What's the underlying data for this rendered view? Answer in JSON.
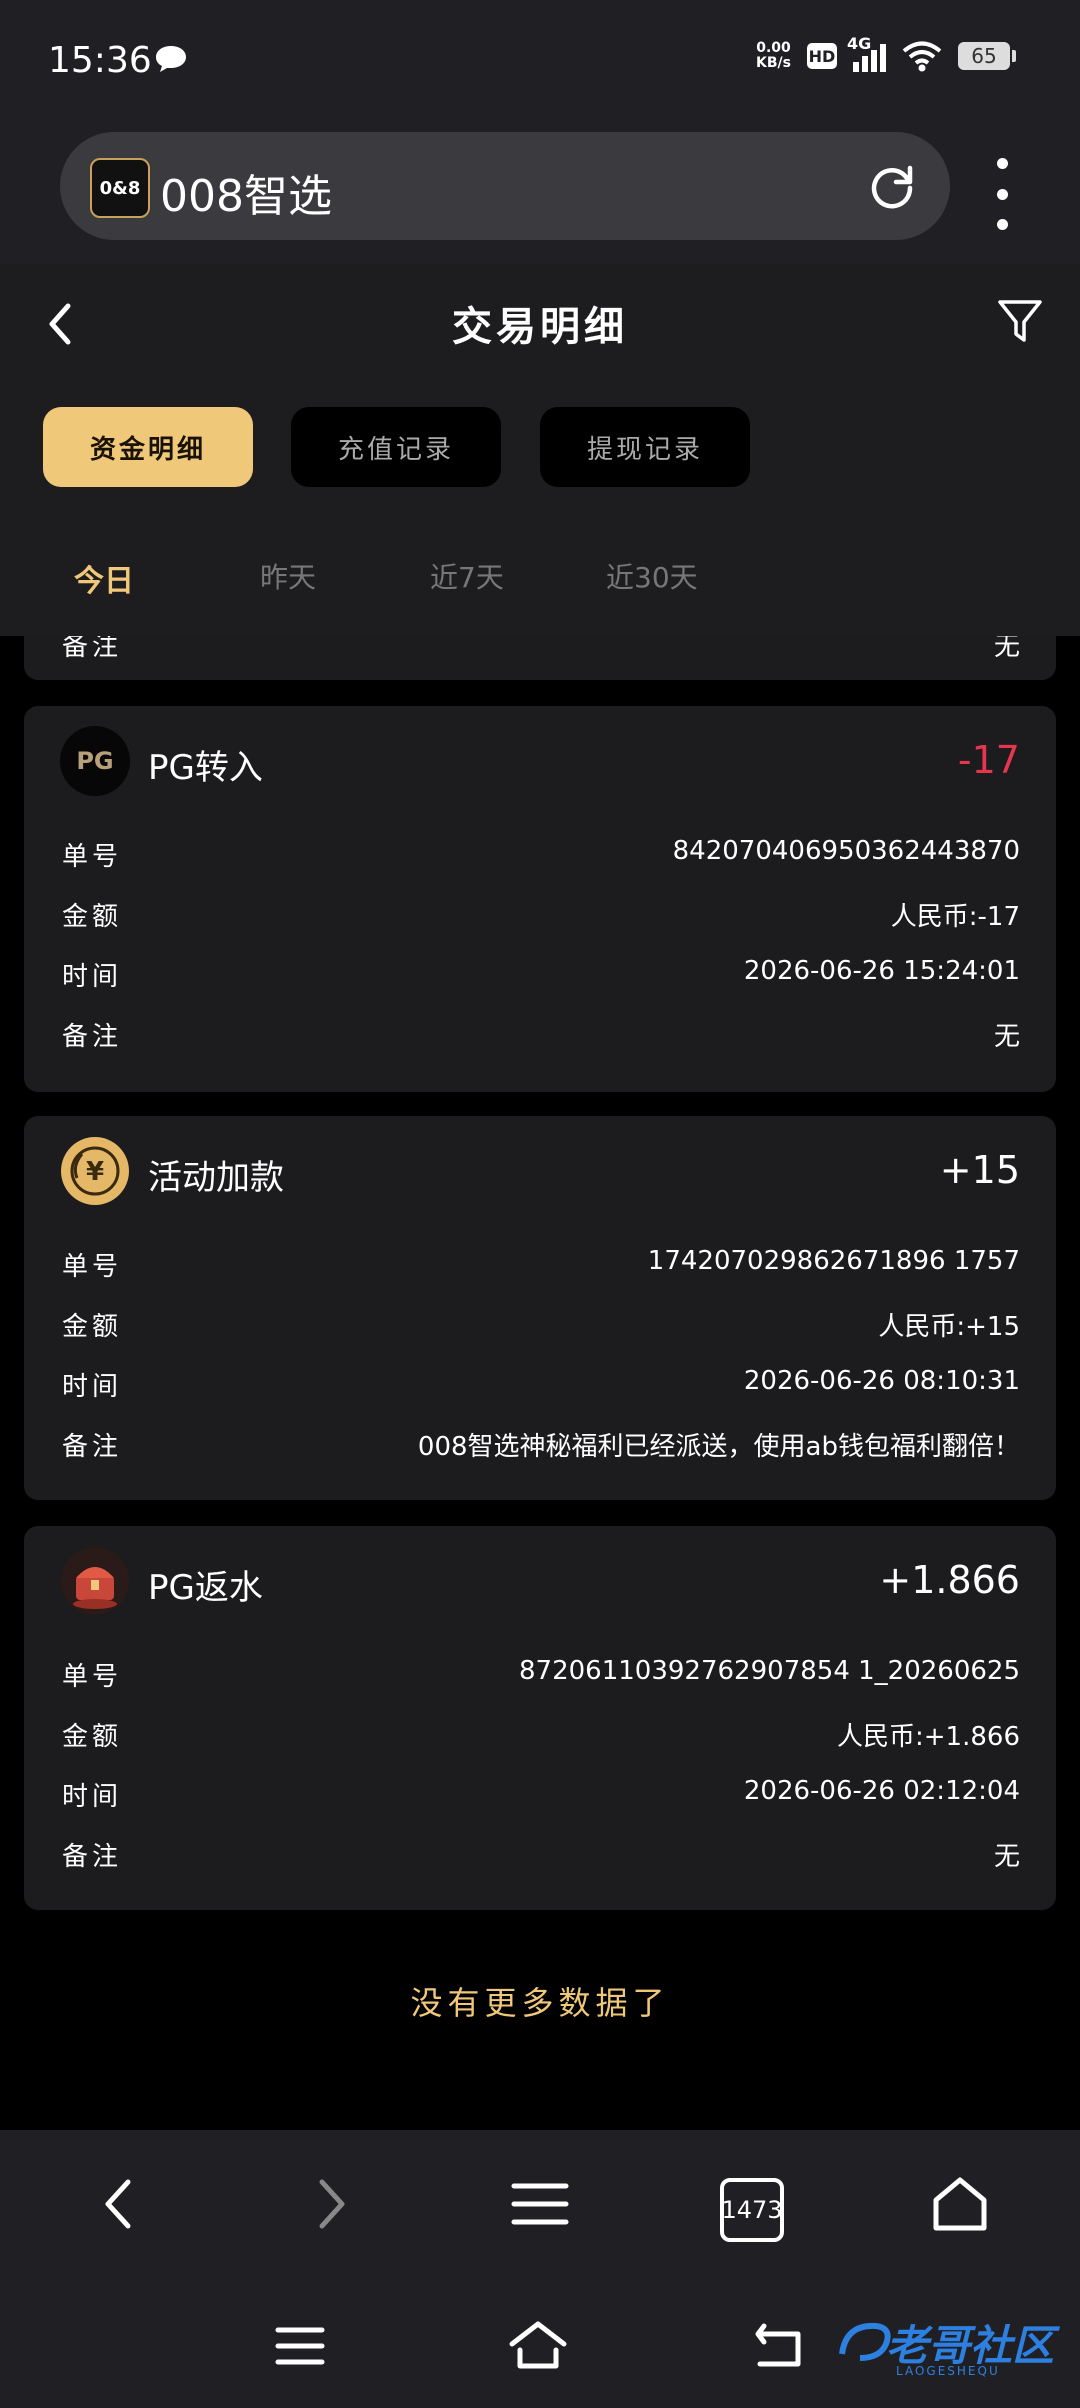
{
  "status_bar": {
    "time": "15:36",
    "net_speed_value": "0.00",
    "net_speed_unit": "KB/s",
    "hd_badge": "HD",
    "network": "4G",
    "battery": "65"
  },
  "browser": {
    "site_title": "008智选",
    "site_logo_text": "0&8",
    "tab_count": "1473"
  },
  "page": {
    "title": "交易明细",
    "segments": [
      {
        "label": "资金明细",
        "active": true
      },
      {
        "label": "充值记录",
        "active": false
      },
      {
        "label": "提现记录",
        "active": false
      }
    ],
    "day_tabs": [
      {
        "label": "今日",
        "active": true
      },
      {
        "label": "昨天",
        "active": false
      },
      {
        "label": "近7天",
        "active": false
      },
      {
        "label": "近30天",
        "active": false
      }
    ],
    "partial_row": {
      "label": "备注",
      "value": "无"
    },
    "field_labels": {
      "order": "单号",
      "amount": "金额",
      "time": "时间",
      "note": "备注"
    },
    "records": [
      {
        "icon": "pg-logo-icon",
        "icon_text": "PG",
        "type": "PG转入",
        "amount": "-17",
        "order": "842070406950362443870",
        "amount_detail": "人民币:-17",
        "time": "2026-06-26 15:24:01",
        "note": "无"
      },
      {
        "icon": "yuan-coin-icon",
        "type": "活动加款",
        "amount": "+15",
        "order": "174207029862671896 1757",
        "amount_detail": "人民币:+15",
        "time": "2026-06-26 08:10:31",
        "note": "008智选神秘福利已经派送，使用ab钱包福利翻倍！"
      },
      {
        "icon": "treasure-chest-icon",
        "type": "PG返水",
        "amount": "+1.866",
        "order": "87206110392762907854 1_20260625",
        "amount_detail": "人民币:+1.866",
        "time": "2026-06-26 02:12:04",
        "note": "无"
      }
    ],
    "no_more": "没有更多数据了"
  },
  "watermark": {
    "text": "老哥社区",
    "sub": "LAOGESHEQU"
  },
  "colors": {
    "accent_gold": "#f0c879",
    "negative": "#e8354f",
    "card_bg": "#1c1c1f",
    "bar_bg": "#202024"
  }
}
